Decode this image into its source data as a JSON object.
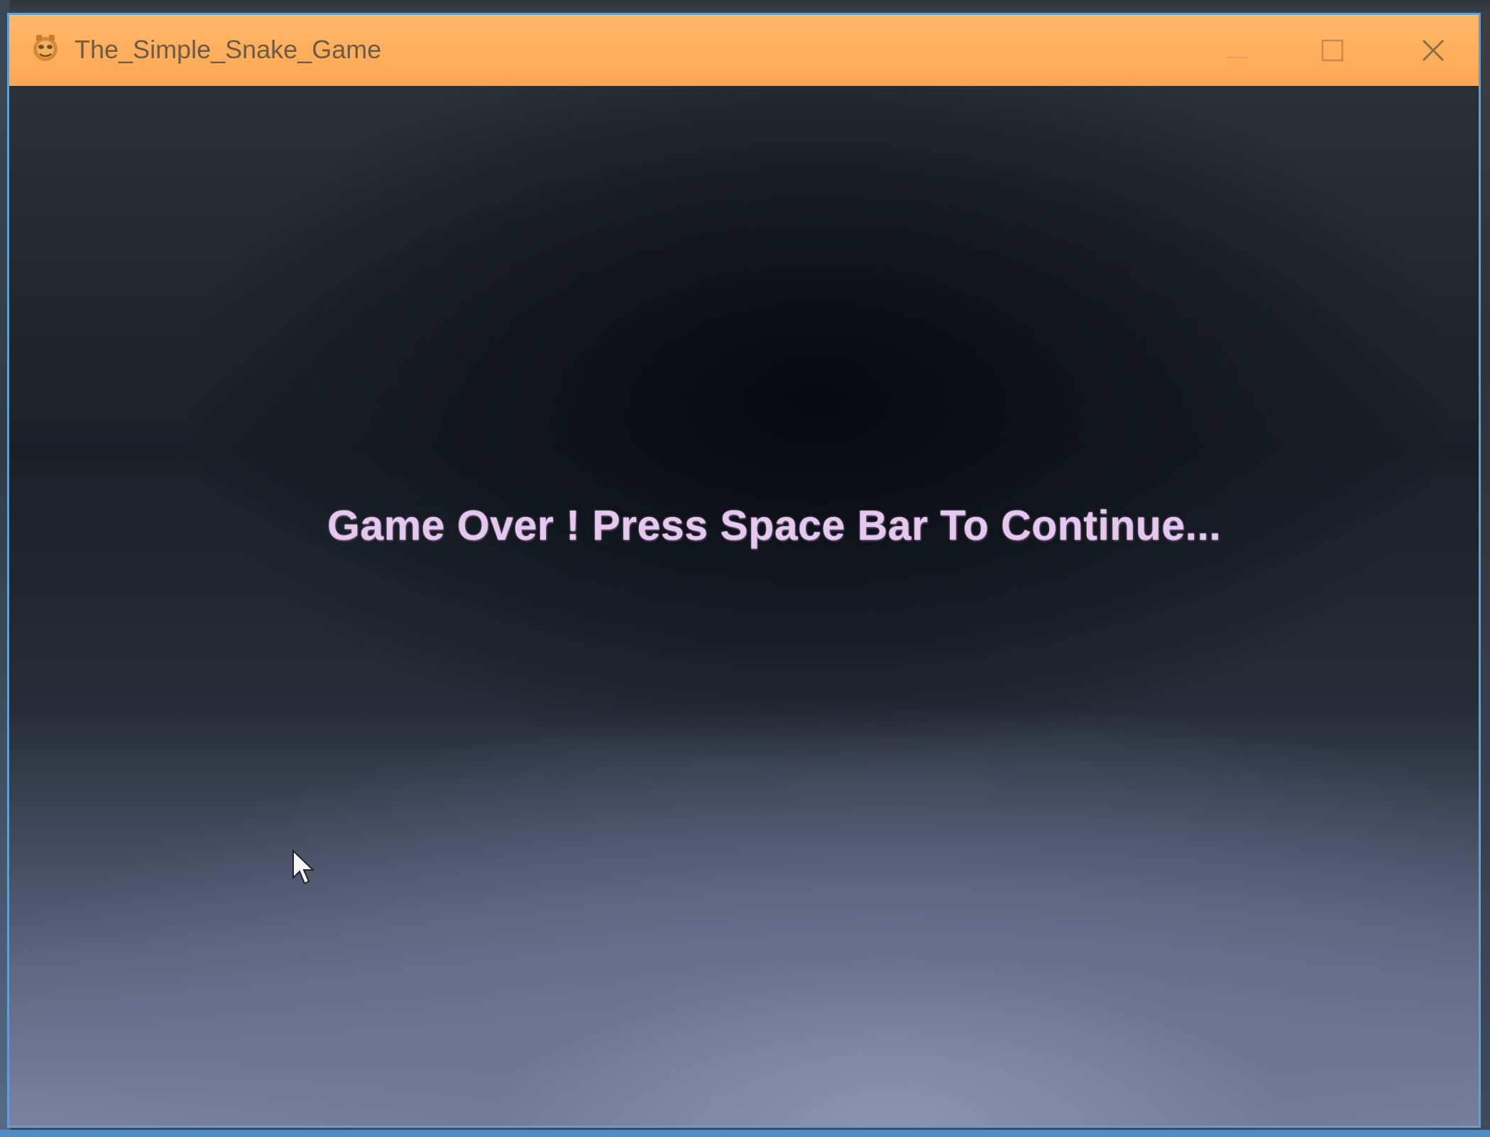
{
  "window": {
    "title": "The_Simple_Snake_Game",
    "controls": {
      "minimize_icon": "minimize-icon",
      "maximize_icon": "maximize-icon",
      "close_icon": "close-icon"
    },
    "titlebar_color": "#ffb768"
  },
  "game": {
    "message": "Game Over ! Press Space Bar To Continue...",
    "message_color": "#e6c7ee"
  },
  "cursor": {
    "icon": "mouse-pointer-icon"
  }
}
